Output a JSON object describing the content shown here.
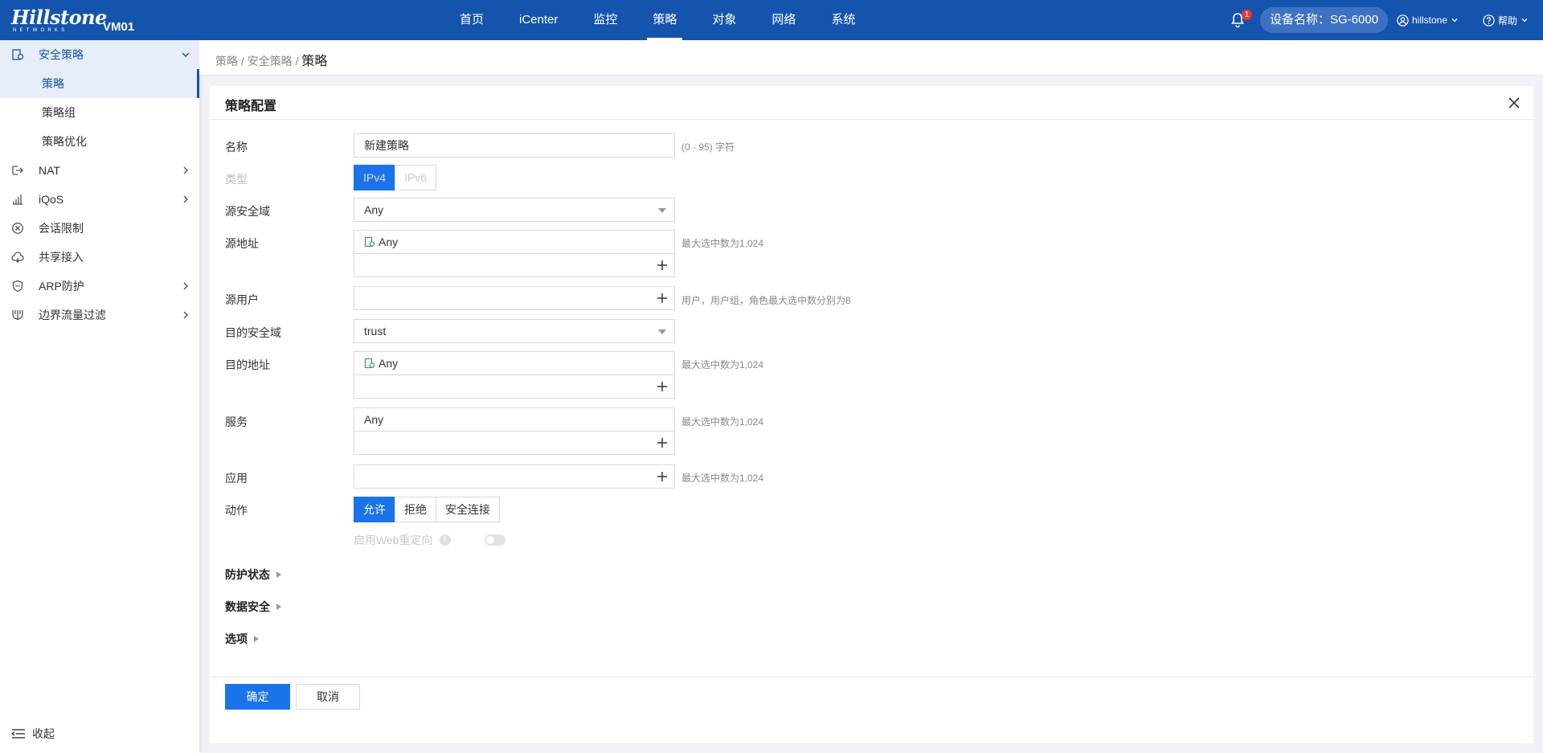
{
  "brand": {
    "logo_main": "Hillstone",
    "logo_sub": "NETWORKS",
    "model": "VM01"
  },
  "nav": {
    "items": [
      "首页",
      "iCenter",
      "监控",
      "策略",
      "对象",
      "网络",
      "系统"
    ],
    "active": "策略"
  },
  "header": {
    "notification_count": "1",
    "device_label": "设备名称：SG-6000",
    "user": "hillstone",
    "help": "帮助"
  },
  "sidebar": {
    "groups": [
      {
        "label": "安全策略",
        "open": true,
        "subitems": [
          "策略",
          "策略组",
          "策略优化"
        ]
      },
      {
        "label": "NAT"
      },
      {
        "label": "iQoS"
      },
      {
        "label": "会话限制"
      },
      {
        "label": "共享接入"
      },
      {
        "label": "ARP防护"
      },
      {
        "label": "边界流量过滤"
      }
    ],
    "collapse": "收起"
  },
  "breadcrumb": {
    "part1": "策略",
    "sep": "/",
    "part2": "安全策略",
    "current": "策略"
  },
  "form": {
    "title": "策略配置",
    "name_label": "名称",
    "name_value": "新建策略",
    "name_hint": "(0 - 95) 字符",
    "type_label": "类型",
    "type_options": [
      "IPv4",
      "IPv6"
    ],
    "src_zone_label": "源安全域",
    "src_zone_value": "Any",
    "src_addr_label": "源地址",
    "src_addr_value": "Any",
    "src_addr_hint": "最大选中数为1,024",
    "src_user_label": "源用户",
    "src_user_hint": "用户，用户组，角色最大选中数分别为8",
    "dst_zone_label": "目的安全域",
    "dst_zone_value": "trust",
    "dst_addr_label": "目的地址",
    "dst_addr_value": "Any",
    "dst_addr_hint": "最大选中数为1,024",
    "service_label": "服务",
    "service_value": "Any",
    "service_hint": "最大选中数为1,024",
    "app_label": "应用",
    "app_hint": "最大选中数为1,024",
    "action_label": "动作",
    "action_options": [
      "允许",
      "拒绝",
      "安全连接"
    ],
    "web_redirect_label": "启用Web重定向",
    "sections": [
      "防护状态",
      "数据安全",
      "选项"
    ],
    "ok": "确定",
    "cancel": "取消"
  }
}
